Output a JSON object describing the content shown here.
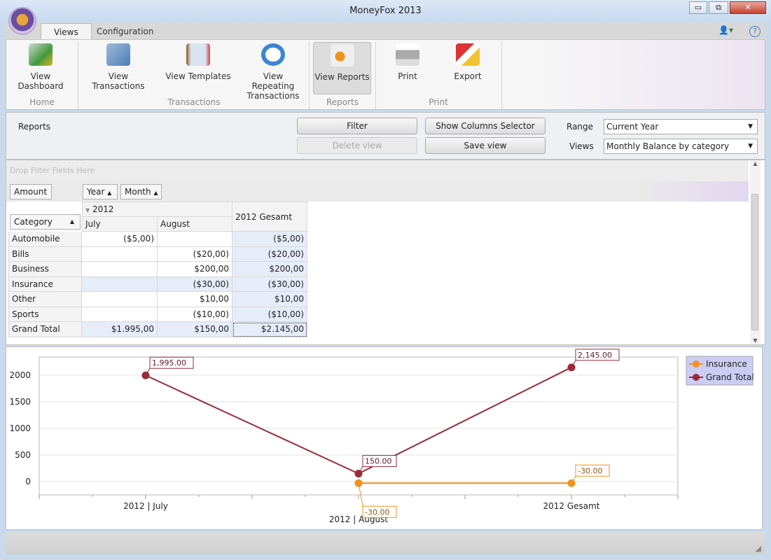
{
  "window": {
    "title": "MoneyFox 2013",
    "min": "▭",
    "max": "⧉",
    "close": "✕"
  },
  "tabs": [
    {
      "label": "Views"
    },
    {
      "label": "Configuration"
    }
  ],
  "ribbon": {
    "buttons": [
      {
        "label": "View Dashboard",
        "icon": "dashboard-icon"
      },
      {
        "label": "View Transactions",
        "icon": "cash-register-icon"
      },
      {
        "label": "View Templates",
        "icon": "templates-icon"
      },
      {
        "label": "View Repeating Transactions",
        "icon": "repeat-icon"
      },
      {
        "label": "View Reports",
        "icon": "reports-icon"
      },
      {
        "label": "Print",
        "icon": "printer-icon"
      },
      {
        "label": "Export",
        "icon": "export-icon"
      }
    ],
    "groups": [
      "Home",
      "Transactions",
      "Reports",
      "Print"
    ],
    "help": "?"
  },
  "reports": {
    "label": "Reports",
    "filter": "Filter",
    "delete_view": "Delete view",
    "show_columns": "Show Columns Selector",
    "save_view": "Save view",
    "range_label": "Range",
    "range_value": "Current Year",
    "views_label": "Views",
    "views_value": "Monthly Balance by category"
  },
  "pivot": {
    "filter_placeholder": "Drop Filter Fields Here",
    "data_field": "Amount",
    "column_fields": [
      "Year",
      "Month"
    ],
    "row_field": "Category",
    "year": "2012",
    "columns": [
      "July",
      "August"
    ],
    "total_column": "2012 Gesamt",
    "rows": [
      {
        "category": "Automobile",
        "values": [
          "($5,00)",
          "",
          "($5,00)"
        ]
      },
      {
        "category": "Bills",
        "values": [
          "",
          "($20,00)",
          "($20,00)"
        ]
      },
      {
        "category": "Business",
        "values": [
          "",
          "$200,00",
          "$200,00"
        ]
      },
      {
        "category": "Insurance",
        "values": [
          "",
          "($30,00)",
          "($30,00)"
        ]
      },
      {
        "category": "Other",
        "values": [
          "",
          "$10,00",
          "$10,00"
        ]
      },
      {
        "category": "Sports",
        "values": [
          "",
          "($10,00)",
          "($10,00)"
        ]
      },
      {
        "category": "Grand Total",
        "values": [
          "$1.995,00",
          "$150,00",
          "$2.145,00"
        ]
      }
    ]
  },
  "chart_data": {
    "type": "line",
    "categories": [
      "2012 | July",
      "2012 | August",
      "2012 Gesamt"
    ],
    "ylim": [
      -250,
      2340
    ],
    "yticks": [
      0,
      500,
      1000,
      1500,
      2000
    ],
    "grid": true,
    "legend_position": "top-right",
    "series": [
      {
        "name": "Insurance",
        "color": "#f0921e",
        "values": [
          null,
          -30,
          -30
        ],
        "labels": [
          "",
          "-30.00",
          "-30.00"
        ]
      },
      {
        "name": "Grand Total",
        "color": "#9b2a3a",
        "values": [
          1995,
          150,
          2145
        ],
        "labels": [
          "1,995.00",
          "150.00",
          "2,145.00"
        ]
      }
    ]
  }
}
